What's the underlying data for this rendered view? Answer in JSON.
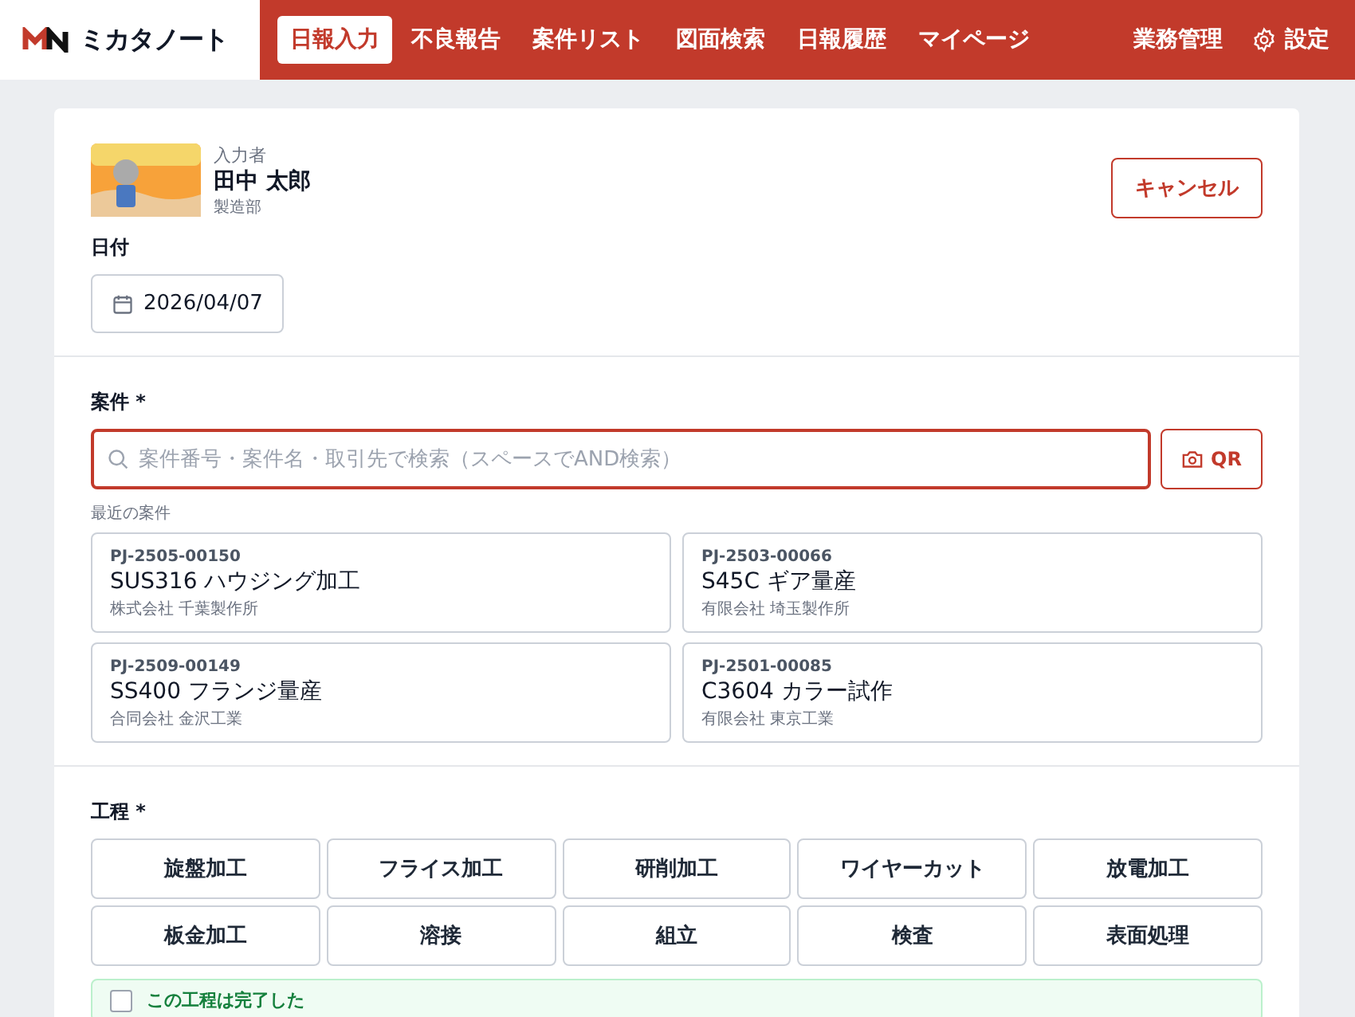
{
  "header": {
    "logo": "ミカタノート",
    "nav": [
      {
        "label": "日報入力",
        "selected": true
      },
      {
        "label": "不良報告",
        "selected": false
      },
      {
        "label": "案件リスト",
        "selected": false
      },
      {
        "label": "図面検索",
        "selected": false
      },
      {
        "label": "日報履歴",
        "selected": false
      },
      {
        "label": "マイページ",
        "selected": false
      }
    ],
    "admin": "業務管理",
    "settings": "設定"
  },
  "reporter": {
    "caption": "入力者",
    "name": "田中 太郎",
    "department": "製造部"
  },
  "cancel": "キャンセル",
  "date": {
    "label": "日付",
    "value": "2026/04/07"
  },
  "project": {
    "label": "案件 *",
    "placeholder": "案件番号・案件名・取引先で検索（スペースでAND検索）",
    "qr": "QR",
    "recent_label": "最近の案件",
    "recent": [
      {
        "code": "PJ-2505-00150",
        "name": "SUS316 ハウジング加工",
        "client": "株式会社 千葉製作所"
      },
      {
        "code": "PJ-2503-00066",
        "name": "S45C ギア量産",
        "client": "有限会社 埼玉製作所"
      },
      {
        "code": "PJ-2509-00149",
        "name": "SS400 フランジ量産",
        "client": "合同会社 金沢工業"
      },
      {
        "code": "PJ-2501-00085",
        "name": "C3604 カラー試作",
        "client": "有限会社 東京工業"
      }
    ]
  },
  "process": {
    "label": "工程 *",
    "options": [
      {
        "label": "旋盤加工",
        "selected": false
      },
      {
        "label": "フライス加工",
        "selected": false
      },
      {
        "label": "研削加工",
        "selected": false
      },
      {
        "label": "ワイヤーカット",
        "selected": false
      },
      {
        "label": "放電加工",
        "selected": false
      },
      {
        "label": "板金加工",
        "selected": false
      },
      {
        "label": "溶接",
        "selected": false
      },
      {
        "label": "組立",
        "selected": false
      },
      {
        "label": "検査",
        "selected": false
      },
      {
        "label": "表面処理",
        "selected": false
      }
    ],
    "completed": {
      "label": "この工程は完了した",
      "checked": false
    }
  }
}
